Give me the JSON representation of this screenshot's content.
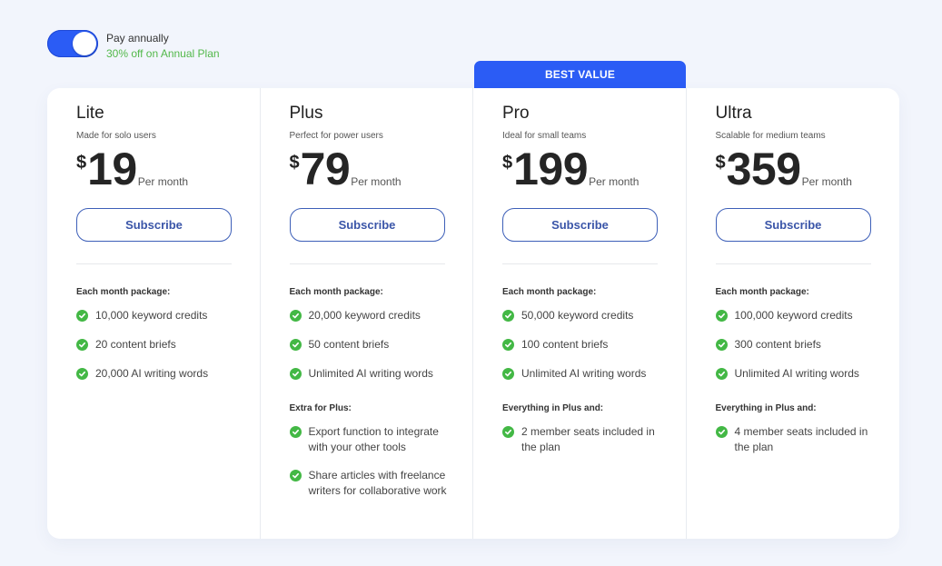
{
  "billing": {
    "toggle_on": true,
    "label": "Pay annually",
    "discount": "30% off on Annual Plan",
    "accent_color": "#2b5cf5",
    "discount_color": "#52b84a"
  },
  "badge": {
    "label": "BEST VALUE"
  },
  "plans": [
    {
      "name": "Lite",
      "tagline": "Made for solo users",
      "currency": "$",
      "price": "19",
      "period": "Per month",
      "cta": "Subscribe",
      "section_label": "Each month package:",
      "features": [
        "10,000 keyword credits",
        "20 content briefs",
        "20,000 AI writing words"
      ]
    },
    {
      "name": "Plus",
      "tagline": "Perfect for power users",
      "currency": "$",
      "price": "79",
      "period": "Per month",
      "cta": "Subscribe",
      "section_label": "Each month package:",
      "features": [
        "20,000 keyword credits",
        "50 content briefs",
        "Unlimited AI writing words"
      ],
      "extra_label": "Extra for Plus:",
      "extra_features": [
        "Export function to integrate with your other tools",
        "Share articles with freelance writers for collaborative work"
      ]
    },
    {
      "name": "Pro",
      "tagline": "Ideal for small teams",
      "currency": "$",
      "price": "199",
      "period": "Per month",
      "cta": "Subscribe",
      "section_label": "Each month package:",
      "features": [
        "50,000 keyword credits",
        "100 content briefs",
        "Unlimited AI writing words"
      ],
      "extra_label": "Everything in Plus and:",
      "extra_features": [
        "2 member seats included in the plan"
      ]
    },
    {
      "name": "Ultra",
      "tagline": "Scalable for medium teams",
      "currency": "$",
      "price": "359",
      "period": "Per month",
      "cta": "Subscribe",
      "section_label": "Each month package:",
      "features": [
        "100,000 keyword credits",
        "300 content briefs",
        "Unlimited AI writing words"
      ],
      "extra_label": "Everything in Plus and:",
      "extra_features": [
        "4 member seats included in the plan"
      ]
    }
  ]
}
